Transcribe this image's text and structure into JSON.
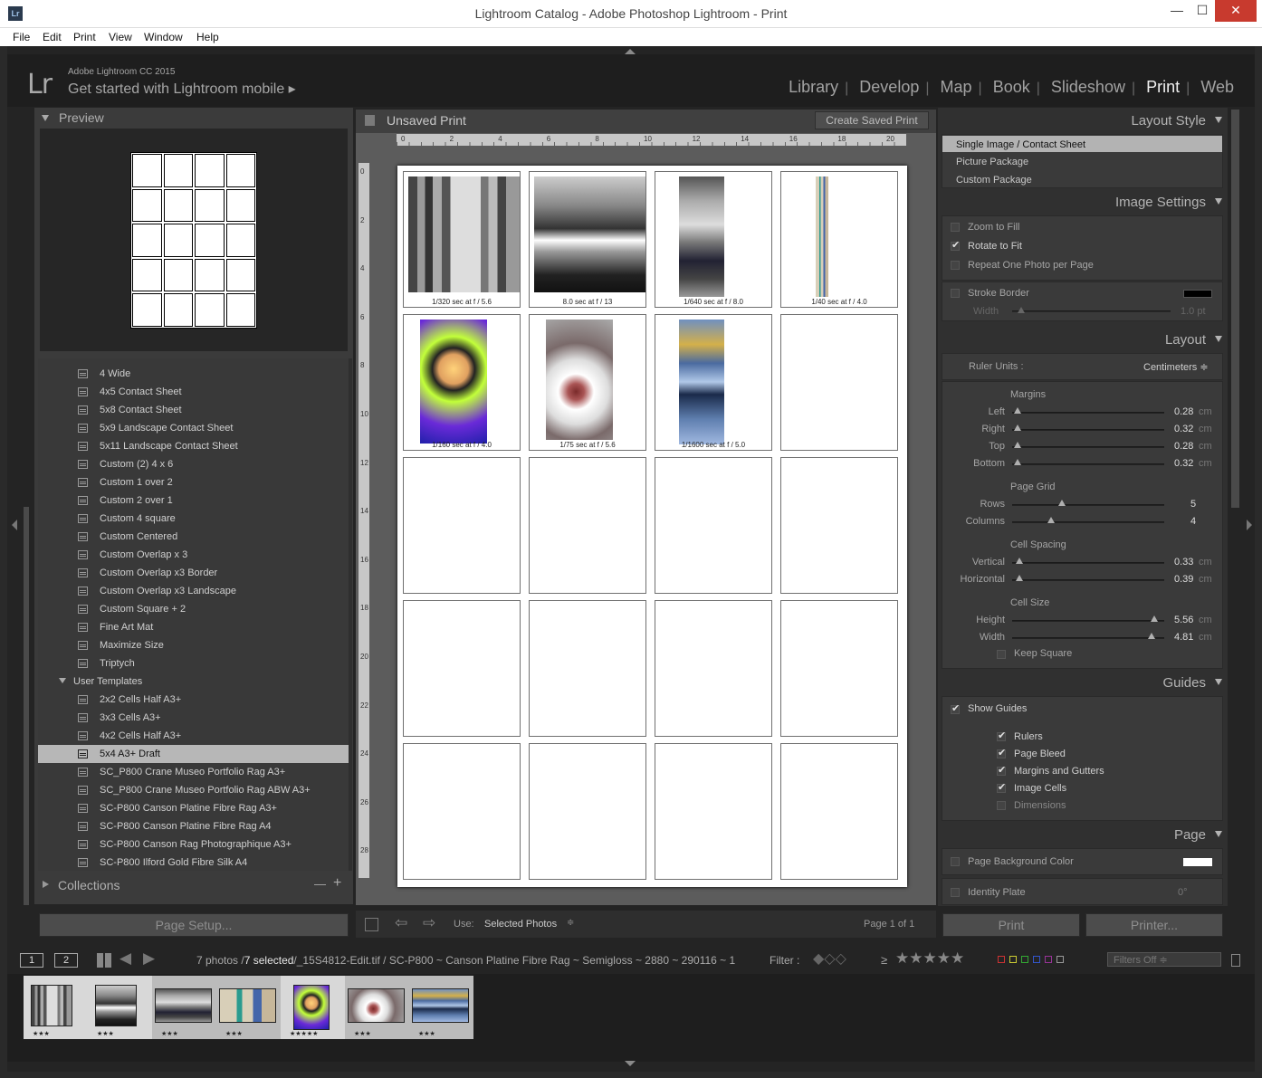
{
  "window": {
    "title": "Lightroom Catalog - Adobe Photoshop Lightroom - Print",
    "app_icon": "Lr",
    "minimize": "—",
    "maximize": "☐",
    "close": "✕"
  },
  "menu": [
    "File",
    "Edit",
    "Print",
    "View",
    "Window",
    "Help"
  ],
  "identity": {
    "logo": "Lr",
    "line1": "Adobe Lightroom CC 2015",
    "line2": "Get started with Lightroom mobile ▸"
  },
  "modules": [
    "Library",
    "Develop",
    "Map",
    "Book",
    "Slideshow",
    "Print",
    "Web"
  ],
  "active_module": "Print",
  "left": {
    "preview_title": "Preview",
    "templates": [
      {
        "label": "4 Wide"
      },
      {
        "label": "4x5 Contact Sheet"
      },
      {
        "label": "5x8 Contact Sheet"
      },
      {
        "label": "5x9 Landscape Contact Sheet"
      },
      {
        "label": "5x11 Landscape Contact Sheet"
      },
      {
        "label": "Custom (2) 4 x 6"
      },
      {
        "label": "Custom 1 over 2"
      },
      {
        "label": "Custom 2 over 1"
      },
      {
        "label": "Custom 4 square"
      },
      {
        "label": "Custom Centered"
      },
      {
        "label": "Custom Overlap x 3"
      },
      {
        "label": "Custom Overlap x3 Border"
      },
      {
        "label": "Custom Overlap x3 Landscape"
      },
      {
        "label": "Custom Square + 2"
      },
      {
        "label": "Fine Art Mat"
      },
      {
        "label": "Maximize Size"
      },
      {
        "label": "Triptych"
      },
      {
        "label": "User Templates",
        "folder": true
      },
      {
        "label": "2x2 Cells Half A3+"
      },
      {
        "label": "3x3 Cells A3+"
      },
      {
        "label": "4x2 Cells Half A3+"
      },
      {
        "label": "5x4 A3+ Draft",
        "selected": true
      },
      {
        "label": "SC_P800 Crane Museo Portfolio Rag A3+"
      },
      {
        "label": "SC_P800 Crane Museo Portfolio Rag ABW A3+"
      },
      {
        "label": "SC-P800 Canson Platine Fibre Rag A3+"
      },
      {
        "label": "SC-P800 Canson Platine Fibre Rag A4"
      },
      {
        "label": "SC-P800 Canson Rag Photographique A3+"
      },
      {
        "label": "SC-P800 Ilford Gold Fibre Silk A4"
      }
    ],
    "collections_title": "Collections",
    "collections_minus": "—",
    "collections_plus": "+",
    "page_setup": "Page Setup..."
  },
  "center": {
    "title": "Unsaved Print",
    "create_saved": "Create Saved Print",
    "ruler_h": [
      "0",
      "2",
      "4",
      "6",
      "8",
      "10",
      "12",
      "14",
      "16",
      "18",
      "20"
    ],
    "ruler_v": [
      "0",
      "2",
      "4",
      "6",
      "8",
      "10",
      "12",
      "14",
      "16",
      "18",
      "20",
      "22",
      "24",
      "26",
      "28"
    ],
    "captions": [
      "1/320 sec at f / 5.6",
      "8.0 sec at f / 13",
      "1/640 sec at f / 8.0",
      "1/40 sec at f / 4.0",
      "1/160 sec at f / 4.0",
      "1/75 sec at f / 5.6",
      "1/1600 sec at f / 5.0"
    ],
    "use_label": "Use:",
    "use_value": "Selected Photos",
    "page_status": "Page 1 of 1"
  },
  "right": {
    "layout_style": "Layout Style",
    "styles": [
      "Single Image / Contact Sheet",
      "Picture Package",
      "Custom Package"
    ],
    "image_settings": "Image Settings",
    "zoom_to_fill": "Zoom to Fill",
    "rotate_to_fit": "Rotate to Fit",
    "repeat_one": "Repeat One Photo per Page",
    "stroke_border": "Stroke Border",
    "width_label": "Width",
    "stroke_width": "1.0 pt",
    "layout": "Layout",
    "ruler_units": "Ruler Units :",
    "ruler_value": "Centimeters ≑",
    "margins_title": "Margins",
    "margins": [
      {
        "label": "Left",
        "value": "0.28",
        "unit": "cm"
      },
      {
        "label": "Right",
        "value": "0.32",
        "unit": "cm"
      },
      {
        "label": "Top",
        "value": "0.28",
        "unit": "cm"
      },
      {
        "label": "Bottom",
        "value": "0.32",
        "unit": "cm"
      }
    ],
    "page_grid_title": "Page Grid",
    "grid": [
      {
        "label": "Rows",
        "value": "5"
      },
      {
        "label": "Columns",
        "value": "4"
      }
    ],
    "cell_spacing_title": "Cell Spacing",
    "spacing": [
      {
        "label": "Vertical",
        "value": "0.33",
        "unit": "cm"
      },
      {
        "label": "Horizontal",
        "value": "0.39",
        "unit": "cm"
      }
    ],
    "cell_size_title": "Cell Size",
    "cellsize": [
      {
        "label": "Height",
        "value": "5.56",
        "unit": "cm"
      },
      {
        "label": "Width",
        "value": "4.81",
        "unit": "cm"
      }
    ],
    "keep_square": "Keep Square",
    "guides": "Guides",
    "show_guides": "Show Guides",
    "guide_items": [
      "Rulers",
      "Page Bleed",
      "Margins and Gutters",
      "Image Cells",
      "Dimensions"
    ],
    "page": "Page",
    "page_bg": "Page Background Color",
    "identity_plate": "Identity Plate",
    "identity_angle": "0°",
    "print_btn": "Print",
    "printer_btn": "Printer..."
  },
  "filmbar": {
    "info_pre": "7 photos /",
    "info_sel": "7 selected",
    "info_path": "/_15S4812-Edit.tif / SC-P800 ~ Canson Platine Fibre Rag ~ Semigloss ~ 2880 ~ 290116 ~ 1",
    "filter_label": "Filter :",
    "rating_op": "≥",
    "stars": "★★★★★",
    "filters_off": "Filters Off ≑",
    "screen1": "1",
    "screen2": "2"
  },
  "film_ratings": [
    "★★★",
    "★★★",
    "★★★",
    "★★★",
    "★★★★★",
    "★★★",
    "★★★"
  ],
  "colors": {
    "accent_selected": "#b7b7b7",
    "close": "#c83a2e",
    "panel": "#3a3a3a"
  }
}
